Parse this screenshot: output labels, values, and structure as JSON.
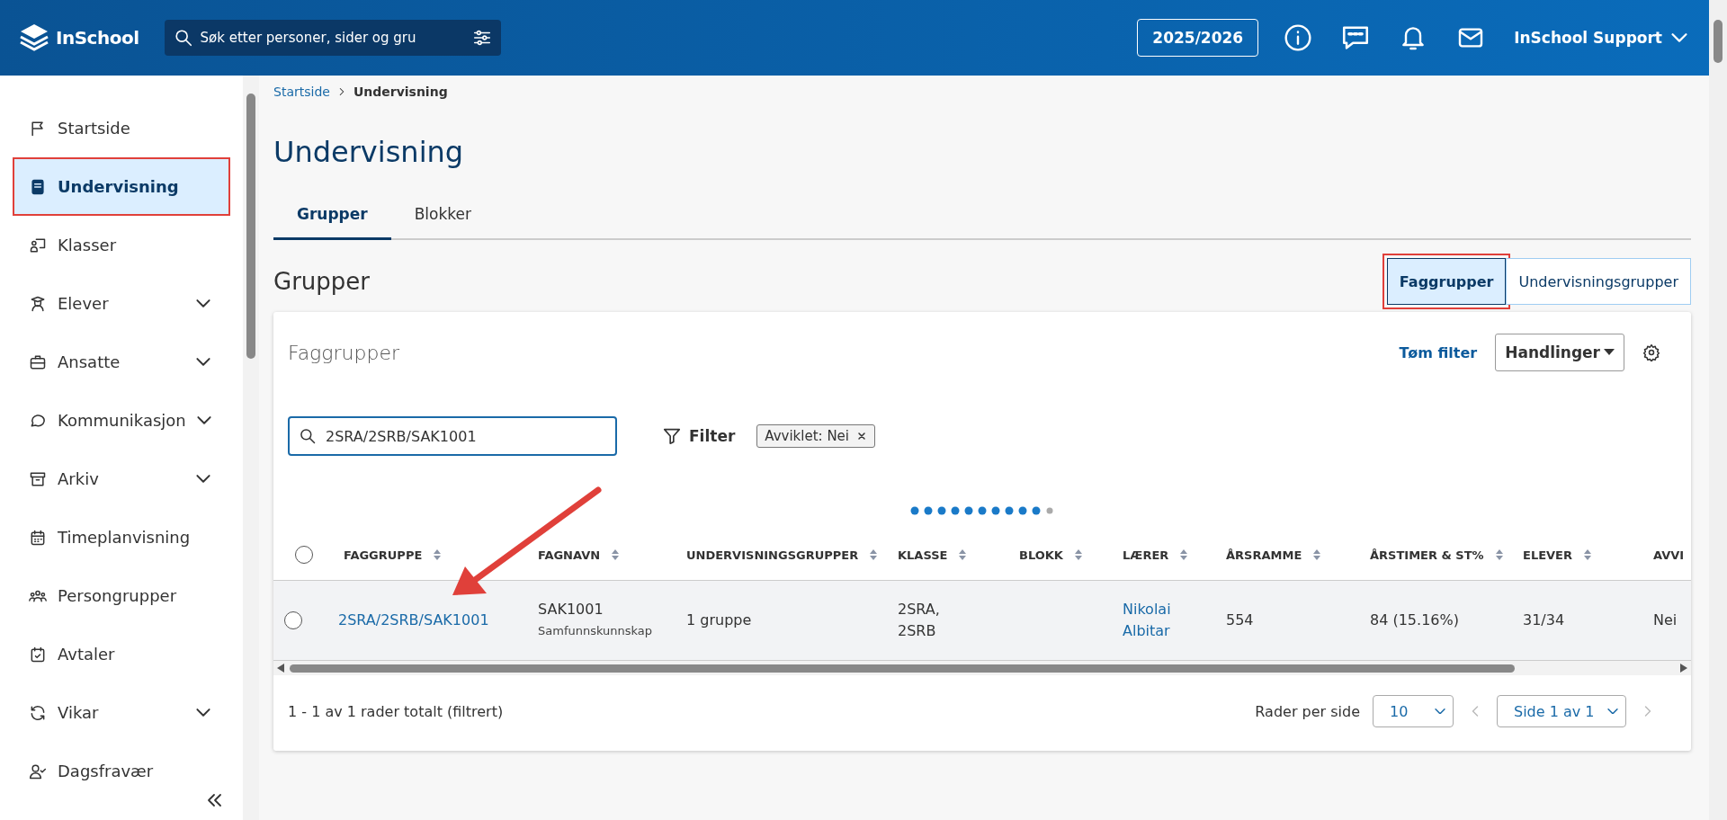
{
  "header": {
    "logo_text": "InSchool",
    "search": {
      "placeholder": "Søk etter personer, sider og gru"
    },
    "school_year": "2025/2026",
    "user": "InSchool Support"
  },
  "sidebar": {
    "items": [
      {
        "label": "Startside",
        "expandable": false,
        "selected": false,
        "highlighted": false
      },
      {
        "label": "Undervisning",
        "expandable": false,
        "selected": true,
        "highlighted": true
      },
      {
        "label": "Klasser",
        "expandable": false,
        "selected": false,
        "highlighted": false
      },
      {
        "label": "Elever",
        "expandable": true,
        "selected": false,
        "highlighted": false
      },
      {
        "label": "Ansatte",
        "expandable": true,
        "selected": false,
        "highlighted": false
      },
      {
        "label": "Kommunikasjon",
        "expandable": true,
        "selected": false,
        "highlighted": false
      },
      {
        "label": "Arkiv",
        "expandable": true,
        "selected": false,
        "highlighted": false
      },
      {
        "label": "Timeplanvisning",
        "expandable": false,
        "selected": false,
        "highlighted": false
      },
      {
        "label": "Persongrupper",
        "expandable": false,
        "selected": false,
        "highlighted": false
      },
      {
        "label": "Avtaler",
        "expandable": false,
        "selected": false,
        "highlighted": false
      },
      {
        "label": "Vikar",
        "expandable": true,
        "selected": false,
        "highlighted": false
      },
      {
        "label": "Dagsfravær",
        "expandable": false,
        "selected": false,
        "highlighted": false
      }
    ]
  },
  "breadcrumb": [
    {
      "label": "Startside",
      "kind": "link"
    },
    {
      "label": "Undervisning",
      "kind": "current"
    }
  ],
  "page_title": "Undervisning",
  "tabs": [
    {
      "label": "Grupper",
      "selected": true
    },
    {
      "label": "Blokker",
      "selected": false
    }
  ],
  "section_title": "Grupper",
  "view_toggle": [
    {
      "label": "Faggrupper",
      "selected": true,
      "highlighted": true
    },
    {
      "label": "Undervisningsgrupper",
      "selected": false,
      "highlighted": false
    }
  ],
  "card": {
    "title": "Faggrupper",
    "clear_filter": "Tøm filter",
    "actions": "Handlinger",
    "search_value": "2SRA/2SRB/SAK1001",
    "filter_label": "Filter",
    "filter_chips": [
      "Avviklet: Nei"
    ],
    "annotation_arrow": true,
    "table": {
      "select_all_checked": false,
      "columns": [
        "FAGGRUPPE",
        "FAGNAVN",
        "UNDERVISNINGSGRUPPER",
        "KLASSE",
        "BLOKK",
        "LÆRER",
        "ÅRSRAMME",
        "ÅRSTIMER & ST%",
        "ELEVER",
        "AVVI"
      ],
      "rows": [
        {
          "checked": false,
          "cells": [
            {
              "kind": "link",
              "lines": [
                "2SRA/2SRB/SAK1001"
              ]
            },
            {
              "kind": "subject",
              "lines": [
                "SAK1001",
                "Samfunnskunnskap"
              ]
            },
            {
              "kind": "text",
              "lines": [
                "1 gruppe"
              ]
            },
            {
              "kind": "text",
              "lines": [
                "2SRA,",
                "2SRB"
              ]
            },
            {
              "kind": "empty"
            },
            {
              "kind": "link",
              "lines": [
                "Nikolai",
                "Albitar"
              ]
            },
            {
              "kind": "text",
              "lines": [
                "554"
              ]
            },
            {
              "kind": "text",
              "lines": [
                "84 (15.16%)"
              ]
            },
            {
              "kind": "text",
              "lines": [
                "31/34"
              ]
            },
            {
              "kind": "text",
              "lines": [
                "Nei"
              ]
            }
          ]
        }
      ]
    },
    "footer": {
      "summary": "1 - 1 av 1 rader totalt (filtrert)",
      "rows_per_page_label": "Rader per side",
      "rows_per_page": "10",
      "page": "Side 1 av 1"
    }
  }
}
